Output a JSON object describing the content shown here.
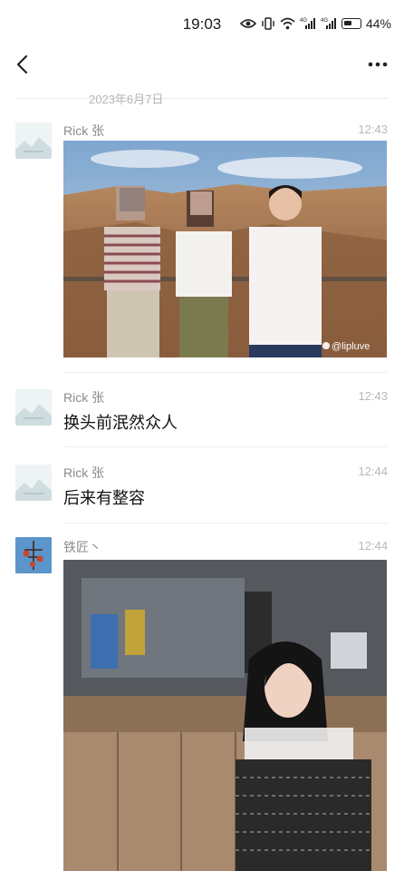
{
  "status": {
    "time": "19:03",
    "battery": "44%"
  },
  "nav": {
    "back_icon": "chevron-left-icon",
    "more_icon": "ellipsis-icon"
  },
  "date_divider": "2023年6月7日",
  "messages": [
    {
      "sender": "Rick 张",
      "time": "12:43",
      "type": "image",
      "watermark": "@lipluve"
    },
    {
      "sender": "Rick 张",
      "time": "12:43",
      "type": "text",
      "text": "换头前泯然众人"
    },
    {
      "sender": "Rick 张",
      "time": "12:44",
      "type": "text",
      "text": "后来有整容"
    },
    {
      "sender": "铁匠丶",
      "time": "12:44",
      "type": "image"
    }
  ]
}
